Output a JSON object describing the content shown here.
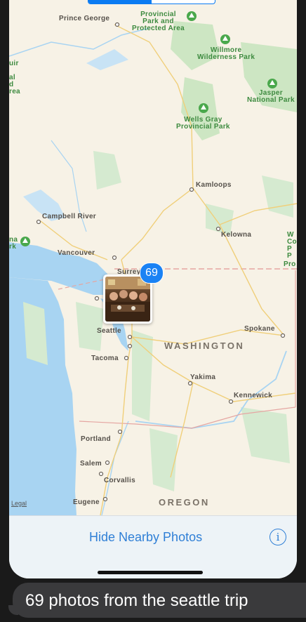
{
  "map": {
    "cities": {
      "prince_george": "Prince George",
      "kamloops": "Kamloops",
      "kelowna": "Kelowna",
      "campbell_river": "Campbell River",
      "vancouver": "Vancouver",
      "surrey": "Surrey",
      "seattle": "Seattle",
      "tacoma": "Tacoma",
      "spokane": "Spokane",
      "yakima": "Yakima",
      "kennewick": "Kennewick",
      "portland": "Portland",
      "salem": "Salem",
      "corvallis": "Corvallis",
      "eugene": "Eugene"
    },
    "parks": {
      "provincial_top": "Provincial\nPark and\nProtected Area",
      "willmore": "Willmore\nWilderness Park",
      "jasper": "Jasper\nNational Park",
      "wells_gray": "Wells Gray\nProvincial Park",
      "left_area": "al\nd\nrea",
      "left_park": "na\nrk"
    },
    "edge_fragments": {
      "left_uir": "uir",
      "right_w": "W\nCo\nP\nP",
      "right_pro": "Pro"
    },
    "states": {
      "washington": "WASHINGTON",
      "oregon": "OREGON"
    },
    "legal": "Legal"
  },
  "cluster": {
    "count": "69"
  },
  "bottom_bar": {
    "hide_label": "Hide Nearby Photos",
    "info_glyph": "i"
  },
  "message": {
    "text": "69 photos from the seattle trip"
  },
  "colors": {
    "land": "#f7f2e6",
    "water": "#a8d4f2",
    "park": "#cde6c3",
    "accent": "#1a82f4",
    "caption_bg": "#3a3a3c"
  }
}
